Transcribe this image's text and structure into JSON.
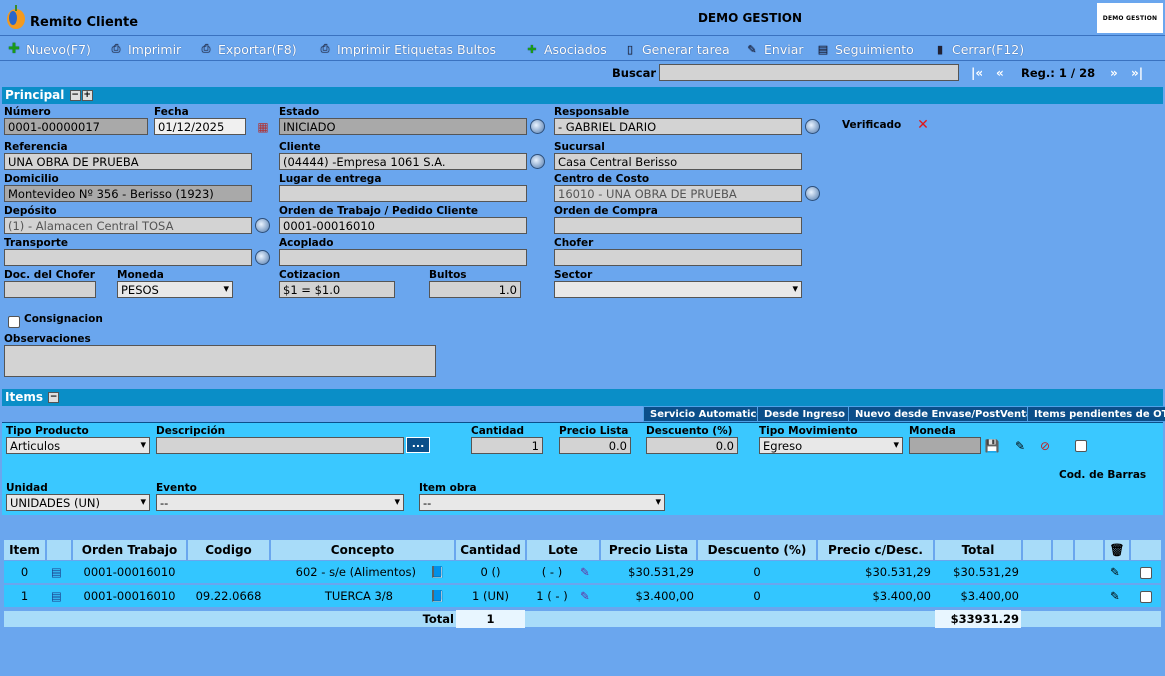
{
  "window": {
    "title": "Remito Cliente",
    "company": "DEMO GESTION",
    "logo_text": "DEMO GESTION"
  },
  "toolbar": {
    "nuevo": "Nuevo(F7)",
    "imprimir": "Imprimir",
    "exportar": "Exportar(F8)",
    "etiquetas": "Imprimir Etiquetas Bultos",
    "asociados": "Asociados",
    "tarea": "Generar tarea",
    "enviar": "Enviar",
    "seguimiento": "Seguimiento",
    "cerrar": "Cerrar(F12)"
  },
  "search": {
    "label": "Buscar",
    "value": "",
    "first": "|«",
    "prev": "«",
    "next": "»",
    "last": "»|",
    "reg": "Reg.: 1 / 28"
  },
  "principal": {
    "title": "Principal",
    "numero_label": "Número",
    "numero": "0001-00000017",
    "fecha_label": "Fecha",
    "fecha": "01/12/2025",
    "estado_label": "Estado",
    "estado": "INICIADO",
    "responsable_label": "Responsable",
    "responsable": "- GABRIEL DARIO",
    "verificado_label": "Verificado",
    "referencia_label": "Referencia",
    "referencia": "UNA OBRA DE PRUEBA",
    "cliente_label": "Cliente",
    "cliente": "(04444) -Empresa 1061 S.A.",
    "sucursal_label": "Sucursal",
    "sucursal": "Casa Central Berisso",
    "domicilio_label": "Domicilio",
    "domicilio": "Montevideo Nº 356 - Berisso (1923)",
    "lugar_label": "Lugar de entrega",
    "lugar": "",
    "centro_label": "Centro de Costo",
    "centro": "16010 - UNA OBRA DE PRUEBA",
    "deposito_label": "Depósito",
    "deposito": "(1) - Alamacen Central TOSA",
    "ot_label": "Orden de Trabajo / Pedido Cliente",
    "ot": "0001-00016010",
    "oc_label": "Orden de Compra",
    "oc": "",
    "transporte_label": "Transporte",
    "transporte": "",
    "acoplado_label": "Acoplado",
    "acoplado": "",
    "chofer_label": "Chofer",
    "chofer": "",
    "doc_chofer_label": "Doc. del Chofer",
    "doc_chofer": "",
    "moneda_label": "Moneda",
    "moneda": "PESOS",
    "cotizacion_label": "Cotizacion",
    "cotizacion": "$1 = $1.0",
    "bultos_label": "Bultos",
    "bultos": "1.0",
    "sector_label": "Sector",
    "sector": "",
    "consignacion_label": "Consignacion",
    "observaciones_label": "Observaciones",
    "observaciones": ""
  },
  "items": {
    "title": "Items",
    "tabs": [
      "Servicio Automatico",
      "Desde Ingreso",
      "Nuevo desde Envase/PostVenta",
      "Items pendientes de OT"
    ],
    "tipo_producto_label": "Tipo Producto",
    "tipo_producto": "Articulos",
    "descripcion_label": "Descripción",
    "descripcion": "",
    "dots": "...",
    "cantidad_label": "Cantidad",
    "cantidad": "1",
    "precio_lista_label": "Precio Lista",
    "precio_lista": "0.0",
    "descuento_label": "Descuento (%)",
    "descuento": "0.0",
    "tipo_mov_label": "Tipo Movimiento",
    "tipo_mov": "Egreso",
    "moneda_label": "Moneda",
    "moneda": "",
    "cod_barras_label": "Cod. de Barras",
    "unidad_label": "Unidad",
    "unidad": "UNIDADES (UN)",
    "evento_label": "Evento",
    "evento": "--",
    "item_obra_label": "Item obra",
    "item_obra": "--"
  },
  "grid": {
    "headers": {
      "item": "Item",
      "ot": "Orden Trabajo",
      "codigo": "Codigo",
      "concepto": "Concepto",
      "cantidad": "Cantidad",
      "lote": "Lote",
      "precio_lista": "Precio Lista",
      "descuento": "Descuento (%)",
      "precio_desc": "Precio c/Desc.",
      "total": "Total"
    },
    "rows": [
      {
        "item": "0",
        "ot": "0001-00016010",
        "codigo": "",
        "concepto": "602 - s/e (Alimentos)",
        "cantidad": "0 ()",
        "lote": "( - )",
        "precio_lista": "$30.531,29",
        "descuento": "0",
        "precio_desc": "$30.531,29",
        "total": "$30.531,29"
      },
      {
        "item": "1",
        "ot": "0001-00016010",
        "codigo": "09.22.0668",
        "concepto": "TUERCA 3/8",
        "cantidad": "1 (UN)",
        "lote": "1 ( - )",
        "precio_lista": "$3.400,00",
        "descuento": "0",
        "precio_desc": "$3.400,00",
        "total": "$3.400,00"
      }
    ],
    "footer": {
      "label": "Total",
      "cantidad": "1",
      "total": "$33931.29"
    }
  }
}
